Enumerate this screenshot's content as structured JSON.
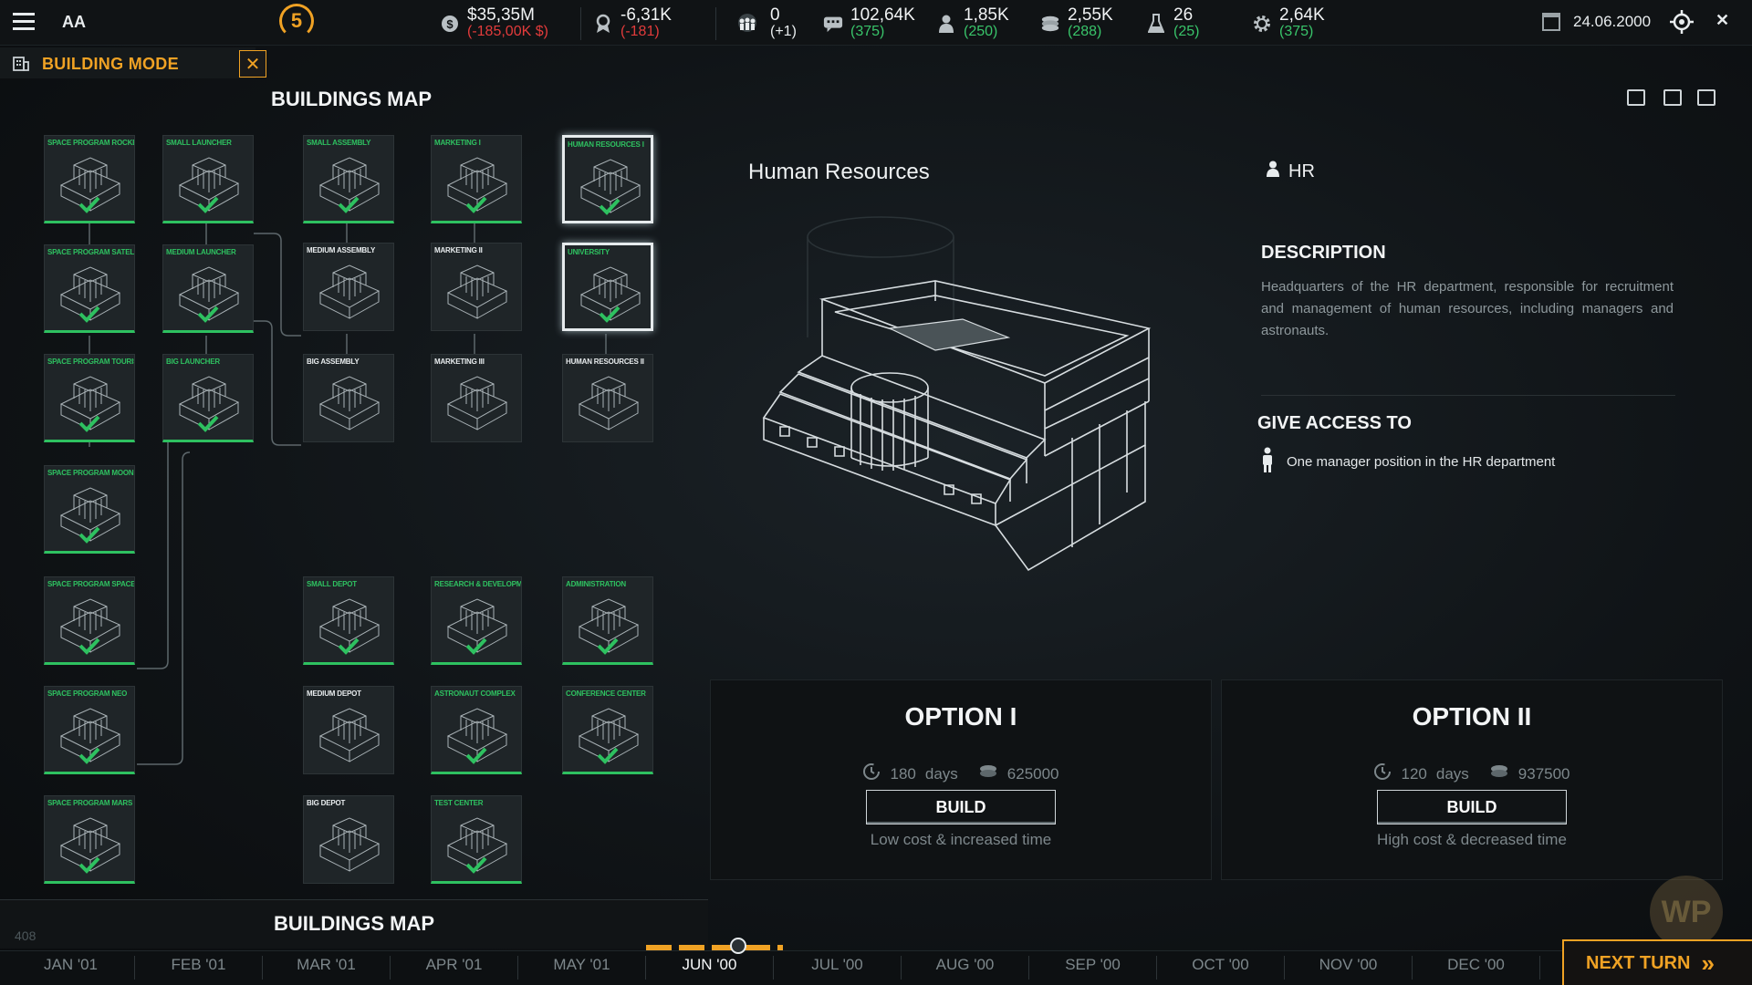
{
  "topbar": {
    "turn": "5",
    "money": {
      "value": "$35,35M",
      "delta": "(-185,00K $)"
    },
    "reputation": {
      "value": "-6,31K",
      "delta": "(-181)"
    },
    "people": {
      "value": "0",
      "delta": "(+1)"
    },
    "chat": {
      "value": "102,64K",
      "delta": "(375)"
    },
    "staff": {
      "value": "1,85K",
      "delta": "(250)"
    },
    "coins": {
      "value": "2,55K",
      "delta": "(288)"
    },
    "science": {
      "value": "26",
      "delta": "(25)"
    },
    "gear": {
      "value": "2,64K",
      "delta": "(375)"
    },
    "date": "24.06.2000",
    "initials": "AA"
  },
  "mode": {
    "label": "BUILDING MODE",
    "close": "✕"
  },
  "panel": {
    "title": "BUILDINGS MAP",
    "bottom_title": "BUILDINGS MAP",
    "bottom_num": "408"
  },
  "tree": {
    "cards": [
      {
        "label": "SPACE PROGRAM ROCKETS",
        "done": true
      },
      {
        "label": "SMALL LAUNCHER",
        "done": true
      },
      {
        "label": "SMALL ASSEMBLY",
        "done": true
      },
      {
        "label": "MARKETING I",
        "done": true
      },
      {
        "label": "HUMAN RESOURCES I",
        "done": true,
        "selected": true
      },
      {
        "label": "SPACE PROGRAM SATELITE",
        "done": true
      },
      {
        "label": "MEDIUM LAUNCHER",
        "done": true
      },
      {
        "label": "MEDIUM ASSEMBLY",
        "done": false
      },
      {
        "label": "MARKETING II",
        "done": false
      },
      {
        "label": "UNIVERSITY",
        "done": true,
        "selected": true
      },
      {
        "label": "SPACE PROGRAM TOURISM",
        "done": true
      },
      {
        "label": "BIG LAUNCHER",
        "done": true
      },
      {
        "label": "BIG ASSEMBLY",
        "done": false
      },
      {
        "label": "MARKETING III",
        "done": false
      },
      {
        "label": "HUMAN RESOURCES II",
        "done": false
      },
      {
        "label": "SPACE PROGRAM MOON",
        "done": true
      },
      {
        "label": "SPACE PROGRAM SPACE STATION",
        "done": true
      },
      {
        "label": "SMALL DEPOT",
        "done": true
      },
      {
        "label": "RESEARCH & DEVELOPMENT",
        "done": true
      },
      {
        "label": "ADMINISTRATION",
        "done": true
      },
      {
        "label": "SPACE PROGRAM NEO",
        "done": true
      },
      {
        "label": "MEDIUM DEPOT",
        "done": false
      },
      {
        "label": "ASTRONAUT COMPLEX",
        "done": true
      },
      {
        "label": "CONFERENCE CENTER",
        "done": true
      },
      {
        "label": "SPACE PROGRAM MARS",
        "done": true
      },
      {
        "label": "BIG DEPOT",
        "done": false
      },
      {
        "label": "TEST CENTER",
        "done": true
      }
    ]
  },
  "detail": {
    "title": "Human Resources",
    "category": "HR",
    "description_heading": "DESCRIPTION",
    "description": "Headquarters of the HR department, responsible for recruitment and management of human resources, including managers and astronauts.",
    "access_heading": "GIVE ACCESS TO",
    "access_item": "One manager position in the HR department"
  },
  "options": [
    {
      "title": "OPTION I",
      "days": "180",
      "days_unit": "days",
      "cost": "625000",
      "button": "BUILD",
      "note": "Low cost & increased time"
    },
    {
      "title": "OPTION II",
      "days": "120",
      "days_unit": "days",
      "cost": "937500",
      "button": "BUILD",
      "note": "High cost & decreased time"
    }
  ],
  "timeline": {
    "months": [
      "JAN '01",
      "FEB '01",
      "MAR '01",
      "APR '01",
      "MAY '01",
      "JUN '00",
      "JUL '00",
      "AUG '00",
      "SEP '00",
      "OCT '00",
      "NOV '00",
      "DEC '00"
    ],
    "current": "JUN '00",
    "next_turn": "NEXT TURN"
  },
  "colors": {
    "accent": "#f0a224",
    "done": "#2ec160",
    "negative": "#e23b3b",
    "positive": "#39c46a"
  }
}
